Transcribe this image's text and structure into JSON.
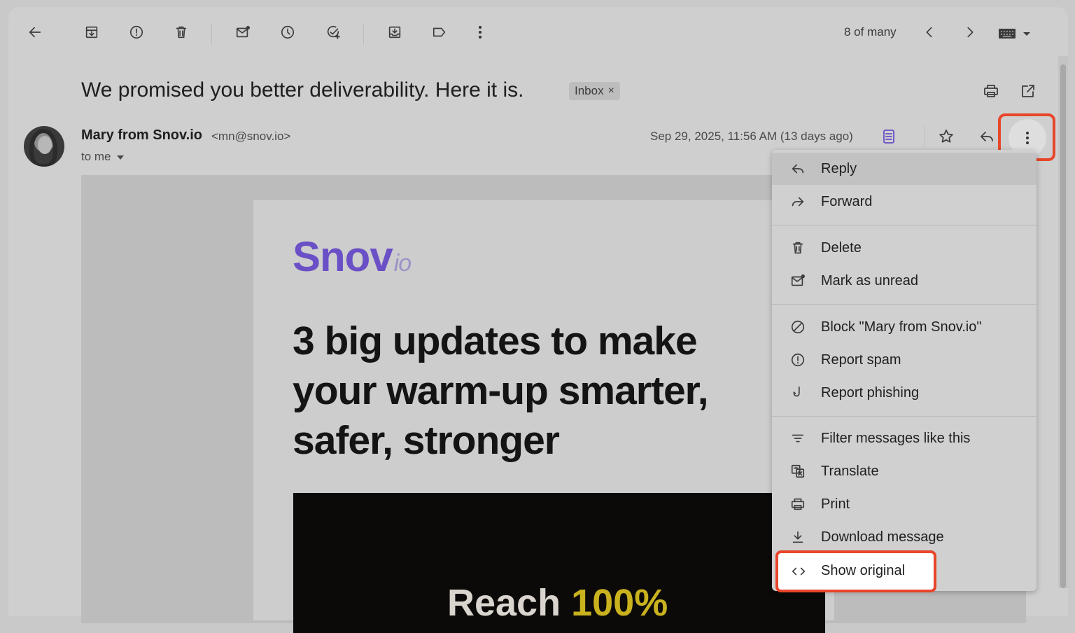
{
  "toolbar": {
    "back": "back-arrow-icon",
    "archive": "archive-icon",
    "spam": "report-spam-icon",
    "delete": "trash-icon",
    "mark_unread": "mark-unread-icon",
    "snooze": "clock-icon",
    "add_task": "add-task-icon",
    "move_to": "move-to-icon",
    "labels": "label-icon",
    "more": "more-vert-icon",
    "pager_text": "8 of many"
  },
  "subject": {
    "title": "We promised you better deliverability. Here it is.",
    "label": "Inbox",
    "label_remove": "×"
  },
  "sender": {
    "name": "Mary from Snov.io",
    "email": "<mn@snov.io>",
    "to": "to me",
    "date": "Sep 29, 2025, 11:56 AM (13 days ago)"
  },
  "email_body": {
    "logo_main": "Snov",
    "logo_suffix": "io",
    "headline": "3 big updates to make your warm-up smarter, safer, stronger",
    "banner_text": "Reach",
    "banner_accent": "100%"
  },
  "menu": {
    "items": [
      {
        "label": "Reply",
        "icon": "reply-icon"
      },
      {
        "label": "Forward",
        "icon": "forward-icon"
      },
      {
        "label": "Delete",
        "icon": "trash-icon"
      },
      {
        "label": "Mark as unread",
        "icon": "mark-unread-icon"
      },
      {
        "label": "Block \"Mary from Snov.io\"",
        "icon": "block-icon"
      },
      {
        "label": "Report spam",
        "icon": "report-spam-icon"
      },
      {
        "label": "Report phishing",
        "icon": "phishing-hook-icon"
      },
      {
        "label": "Filter messages like this",
        "icon": "filter-icon"
      },
      {
        "label": "Translate",
        "icon": "translate-icon"
      },
      {
        "label": "Print",
        "icon": "print-icon"
      },
      {
        "label": "Download message",
        "icon": "download-icon"
      },
      {
        "label": "Show original",
        "icon": "code-icon"
      }
    ]
  },
  "colors": {
    "highlight_border": "#e8462a",
    "brand_purple": "#6a4fc6",
    "banner_accent": "#c9b21e"
  }
}
